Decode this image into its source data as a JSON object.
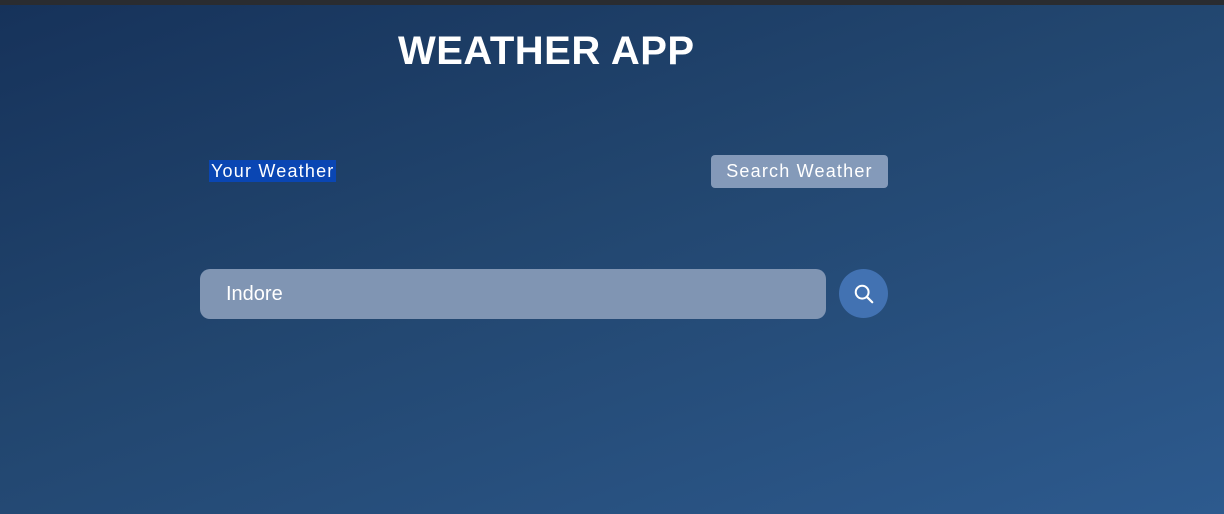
{
  "app": {
    "title": "WEATHER APP"
  },
  "tabs": [
    {
      "label": "Your Weather",
      "active": true
    },
    {
      "label": "Search Weather",
      "active": false
    }
  ],
  "search": {
    "value": "Indore",
    "placeholder": "",
    "button_icon": "search-icon"
  },
  "colors": {
    "background_start": "#16325a",
    "background_end": "#2d5a8e",
    "active_tab": "#0a46b3",
    "search_field": "#8095b3",
    "search_button": "#4272b2"
  }
}
